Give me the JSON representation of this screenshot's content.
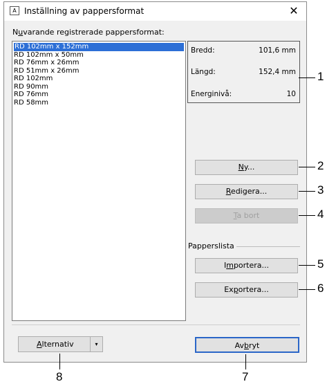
{
  "window": {
    "title": "Inställning av pappersformat",
    "app_icon_text": "A",
    "close_glyph": "✕"
  },
  "paper_list": {
    "label_pre": "N",
    "label_u": "u",
    "label_post": "varande registrerade pappersformat:",
    "items": [
      "RD 102mm x 152mm",
      "RD 102mm x 50mm",
      "RD 76mm x 26mm",
      "RD 51mm x 26mm",
      "RD 102mm",
      "RD 90mm",
      "RD 76mm",
      "RD 58mm"
    ],
    "selected_index": 0
  },
  "info": {
    "width_label": "Bredd:",
    "width_value": "101,6 mm",
    "length_label": "Längd:",
    "length_value": "152,4 mm",
    "energy_label": "Energinivå:",
    "energy_value": "10"
  },
  "buttons": {
    "new": {
      "u": "N",
      "rest": "y..."
    },
    "edit": {
      "u": "R",
      "rest": "edigera..."
    },
    "delete": {
      "u": "T",
      "rest": "a bort",
      "disabled": true
    },
    "import": {
      "pre": "I",
      "u": "m",
      "rest": "portera..."
    },
    "export": {
      "pre": "Ex",
      "u": "p",
      "rest": "ortera..."
    },
    "options": {
      "u": "A",
      "rest": "lternativ",
      "arrow": "▾"
    },
    "cancel": {
      "pre": "Av",
      "u": "b",
      "rest": "ryt"
    }
  },
  "paper_list_group": {
    "label": "Papperslista"
  },
  "callouts": [
    "1",
    "2",
    "3",
    "4",
    "5",
    "6",
    "7",
    "8"
  ]
}
